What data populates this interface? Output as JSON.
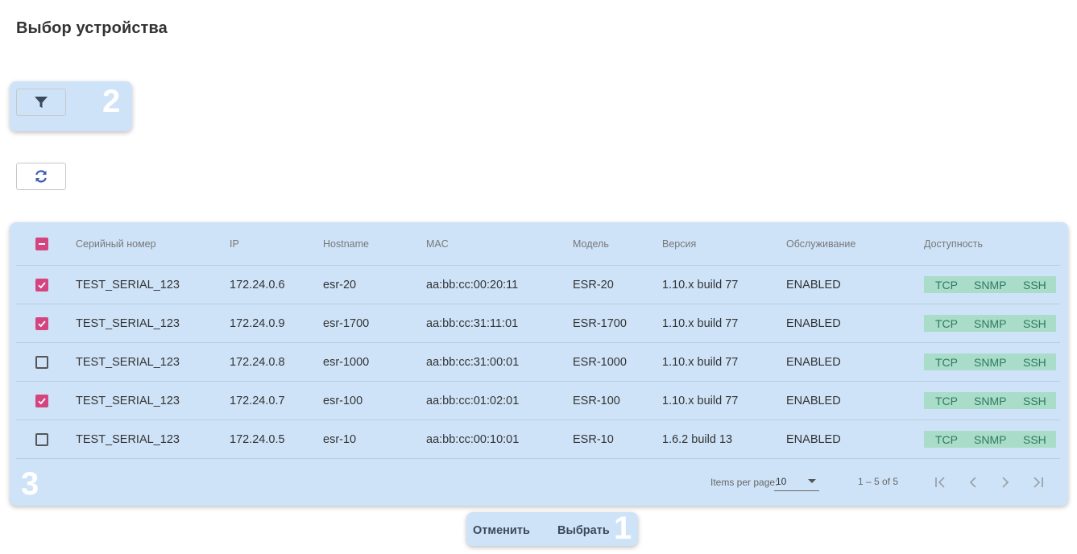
{
  "page": {
    "title": "Выбор устройства"
  },
  "annotations": {
    "actions": "1",
    "filter": "2",
    "table": "3"
  },
  "toolbar": {
    "filter_icon": "filter-icon",
    "refresh_icon": "refresh-icon"
  },
  "table": {
    "headers": {
      "serial": "Серийный номер",
      "ip": "IP",
      "hostname": "Hostname",
      "mac": "MAC",
      "model": "Модель",
      "version": "Версия",
      "service": "Обслуживание",
      "availability": "Доступность"
    },
    "select_all_state": "indeterminate",
    "rows": [
      {
        "checked": true,
        "serial": "TEST_SERIAL_123",
        "ip": "172.24.0.6",
        "hostname": "esr-20",
        "mac": "aa:bb:cc:00:20:11",
        "model": "ESR-20",
        "version": "1.10.x build 77",
        "service": "ENABLED",
        "avail": [
          "TCP",
          "SNMP",
          "SSH"
        ]
      },
      {
        "checked": true,
        "serial": "TEST_SERIAL_123",
        "ip": "172.24.0.9",
        "hostname": "esr-1700",
        "mac": "aa:bb:cc:31:11:01",
        "model": "ESR-1700",
        "version": "1.10.x build 77",
        "service": "ENABLED",
        "avail": [
          "TCP",
          "SNMP",
          "SSH"
        ]
      },
      {
        "checked": false,
        "serial": "TEST_SERIAL_123",
        "ip": "172.24.0.8",
        "hostname": "esr-1000",
        "mac": "aa:bb:cc:31:00:01",
        "model": "ESR-1000",
        "version": "1.10.x build 77",
        "service": "ENABLED",
        "avail": [
          "TCP",
          "SNMP",
          "SSH"
        ]
      },
      {
        "checked": true,
        "serial": "TEST_SERIAL_123",
        "ip": "172.24.0.7",
        "hostname": "esr-100",
        "mac": "aa:bb:cc:01:02:01",
        "model": "ESR-100",
        "version": "1.10.x build 77",
        "service": "ENABLED",
        "avail": [
          "TCP",
          "SNMP",
          "SSH"
        ]
      },
      {
        "checked": false,
        "serial": "TEST_SERIAL_123",
        "ip": "172.24.0.5",
        "hostname": "esr-10",
        "mac": "aa:bb:cc:00:10:01",
        "model": "ESR-10",
        "version": "1.6.2 build 13",
        "service": "ENABLED",
        "avail": [
          "TCP",
          "SNMP",
          "SSH"
        ]
      }
    ]
  },
  "paginator": {
    "items_per_page_label": "Items per page:",
    "page_size": "10",
    "range_label": "1 – 5 of 5"
  },
  "actions": {
    "cancel": "Отменить",
    "select": "Выбрать"
  },
  "colors": {
    "accent": "#d4447f",
    "highlight": "#cfe3f8",
    "availability_bg": "#a9dcc9",
    "availability_text": "#2f7a60"
  }
}
